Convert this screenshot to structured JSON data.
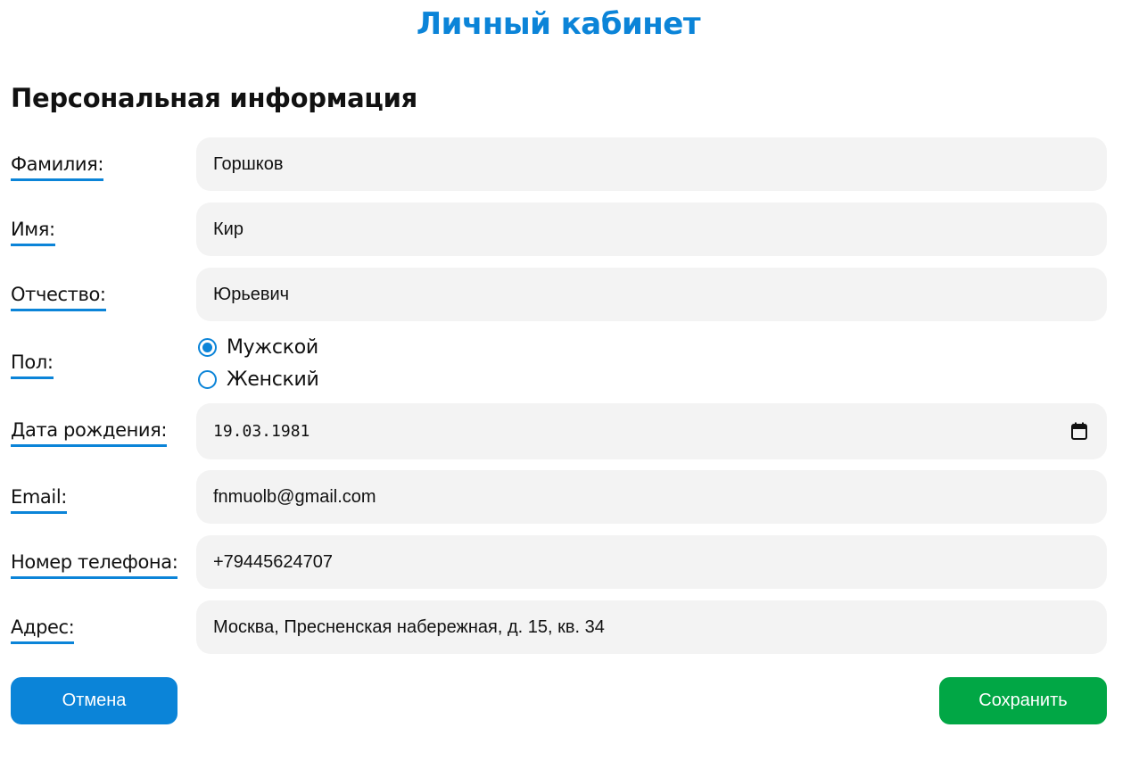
{
  "header": {
    "title": "Личный кабинет"
  },
  "section": {
    "title": "Персональная информация"
  },
  "form": {
    "last_name": {
      "label": "Фамилия:",
      "value": "Горшков"
    },
    "first_name": {
      "label": "Имя:",
      "value": "Кир"
    },
    "patronymic": {
      "label": "Отчество:",
      "value": "Юрьевич"
    },
    "gender": {
      "label": "Пол:",
      "options": [
        {
          "label": "Мужской",
          "checked": true
        },
        {
          "label": "Женский",
          "checked": false
        }
      ]
    },
    "birth_date": {
      "label": "Дата рождения:",
      "value": "19.03.1981",
      "icon": "calendar-icon"
    },
    "email": {
      "label": "Email:",
      "value": "fnmuolb@gmail.com"
    },
    "phone": {
      "label": "Номер телефона:",
      "value": "+79445624707"
    },
    "address": {
      "label": "Адрес:",
      "value": "Москва, Пресненская набережная, д. 15, кв. 34"
    }
  },
  "buttons": {
    "cancel_label": "Отмена",
    "save_label": "Сохранить"
  },
  "colors": {
    "accent": "#0b84d8",
    "save": "#01a745",
    "field_bg": "#f3f3f3"
  }
}
